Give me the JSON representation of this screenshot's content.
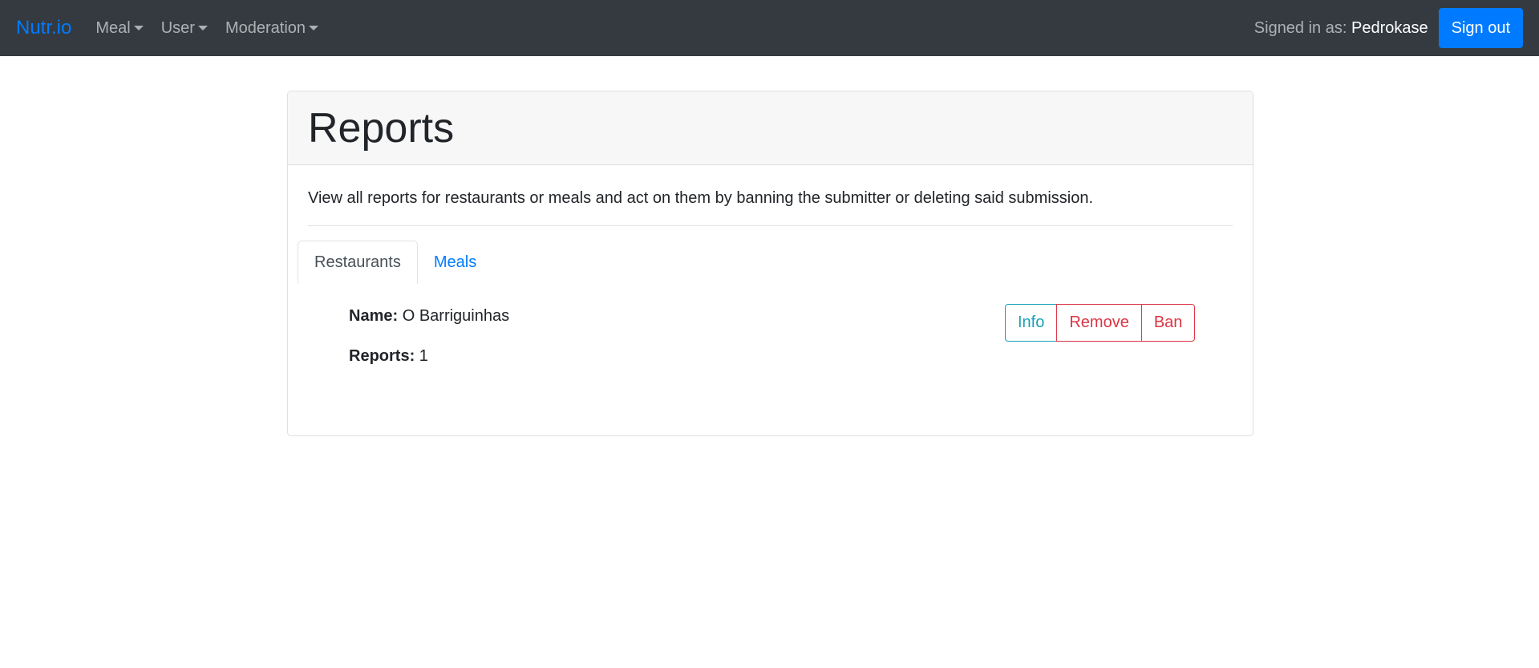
{
  "navbar": {
    "brand": "Nutr.io",
    "menus": [
      {
        "label": "Meal"
      },
      {
        "label": "User"
      },
      {
        "label": "Moderation"
      }
    ],
    "signed_in_prefix": "Signed in as:",
    "username": "Pedrokase",
    "sign_out_label": "Sign out"
  },
  "page": {
    "title": "Reports",
    "description": "View all reports for restaurants or meals and act on them by banning the submitter or deleting said submission."
  },
  "tabs": [
    {
      "label": "Restaurants",
      "active": true
    },
    {
      "label": "Meals",
      "active": false
    }
  ],
  "report": {
    "name_label": "Name:",
    "name_value": "O Barriguinhas",
    "reports_label": "Reports:",
    "reports_value": "1"
  },
  "actions": {
    "info_label": "Info",
    "remove_label": "Remove",
    "ban_label": "Ban"
  },
  "colors": {
    "navbar_bg": "#343a40",
    "primary": "#007bff",
    "info": "#17a2b8",
    "danger": "#dc3545"
  }
}
